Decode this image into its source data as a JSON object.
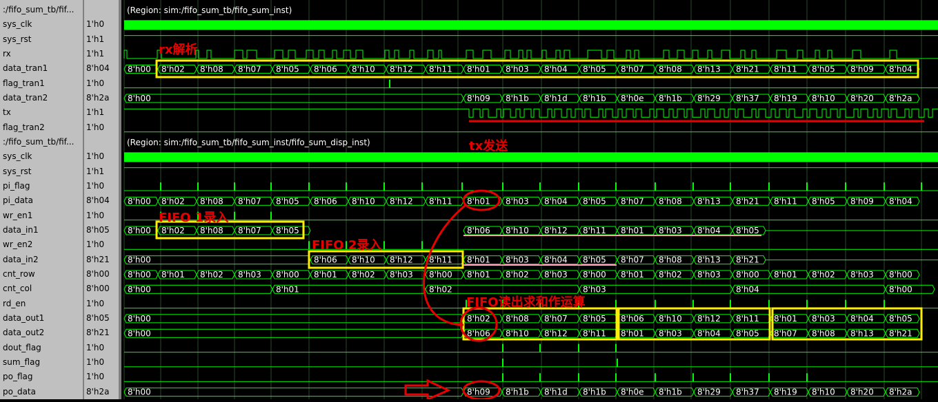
{
  "regions": [
    "(Region: sim:/fifo_sum_tb/fifo_sum_inst)",
    "(Region: sim:/fifo_sum_tb/fifo_sum_inst/fifo_sum_disp_inst)"
  ],
  "signals": [
    {
      "name": ":/fifo_sum_tb/fif...",
      "value": "",
      "kind": "group"
    },
    {
      "name": "sys_clk",
      "value": "1'h0",
      "kind": "clk"
    },
    {
      "name": "sys_rst",
      "value": "1'h1",
      "kind": "high"
    },
    {
      "name": "rx",
      "value": "1'h1",
      "kind": "rx"
    },
    {
      "name": "data_tran1",
      "value": "8'h04",
      "kind": "bus",
      "segs": [
        "8'h00",
        "8'h02",
        "8'h08",
        "8'h07",
        "8'h05",
        "8'h06",
        "8'h10",
        "8'h12",
        "8'h11",
        "8'h01",
        "8'h03",
        "8'h04",
        "8'h05",
        "8'h07",
        "8'h08",
        "8'h13",
        "8'h21",
        "8'h11",
        "8'h05",
        "8'h09",
        "8'h04"
      ]
    },
    {
      "name": "flag_tran1",
      "value": "1'h0",
      "kind": "pulse"
    },
    {
      "name": "data_tran2",
      "value": "8'h2a",
      "kind": "bus2",
      "segs": [
        "8'h00",
        "8'h09",
        "8'h1b",
        "8'h1d",
        "8'h1b",
        "8'h0e",
        "8'h1b",
        "8'h29",
        "8'h37",
        "8'h19",
        "8'h10",
        "8'h20",
        "8'h2a"
      ]
    },
    {
      "name": "tx",
      "value": "1'h1",
      "kind": "tx"
    },
    {
      "name": "flag_tran2",
      "value": "1'h0",
      "kind": "pulse"
    },
    {
      "name": ":/fifo_sum_tb/fif...",
      "value": "",
      "kind": "group"
    },
    {
      "name": "sys_clk",
      "value": "1'h0",
      "kind": "clk"
    },
    {
      "name": "sys_rst",
      "value": "1'h1",
      "kind": "high"
    },
    {
      "name": "pi_flag",
      "value": "1'h0",
      "kind": "pulse"
    },
    {
      "name": "pi_data",
      "value": "8'h04",
      "kind": "bus",
      "segs": [
        "8'h00",
        "8'h02",
        "8'h08",
        "8'h07",
        "8'h05",
        "8'h06",
        "8'h10",
        "8'h12",
        "8'h11",
        "8'h01",
        "8'h03",
        "8'h04",
        "8'h05",
        "8'h07",
        "8'h08",
        "8'h13",
        "8'h21",
        "8'h11",
        "8'h05",
        "8'h09",
        "8'h04"
      ]
    },
    {
      "name": "wr_en1",
      "value": "1'h0",
      "kind": "pulse"
    },
    {
      "name": "data_in1",
      "value": "8'h05",
      "kind": "din1",
      "segs": [
        "8'h00",
        "8'h02",
        "8'h08",
        "8'h07",
        "8'h05",
        "8'h06",
        "8'h10",
        "8'h12",
        "8'h11",
        "8'h01",
        "8'h03",
        "8'h04",
        "8'h05"
      ]
    },
    {
      "name": "wr_en2",
      "value": "1'h0",
      "kind": "pulse"
    },
    {
      "name": "data_in2",
      "value": "8'h21",
      "kind": "din2",
      "segs": [
        "8'h00",
        "8'h06",
        "8'h10",
        "8'h12",
        "8'h11",
        "8'h01",
        "8'h03",
        "8'h04",
        "8'h05",
        "8'h07",
        "8'h08",
        "8'h13",
        "8'h21"
      ]
    },
    {
      "name": "cnt_row",
      "value": "8'h00",
      "kind": "bus",
      "segs": [
        "8'h00",
        "8'h01",
        "8'h02",
        "8'h03",
        "8'h00",
        "8'h01",
        "8'h02",
        "8'h03",
        "8'h00",
        "8'h01",
        "8'h02",
        "8'h03",
        "8'h00",
        "8'h01",
        "8'h02",
        "8'h03",
        "8'h00",
        "8'h01",
        "8'h02",
        "8'h03",
        "8'h00"
      ]
    },
    {
      "name": "cnt_col",
      "value": "8'h00",
      "kind": "col",
      "segs": [
        "8'h00",
        "8'h01",
        "8'h02",
        "8'h03",
        "8'h04",
        "8'h00"
      ]
    },
    {
      "name": "rd_en",
      "value": "1'h0",
      "kind": "pulse"
    },
    {
      "name": "data_out1",
      "value": "8'h05",
      "kind": "dout",
      "segs": [
        "8'h00",
        "8'h02",
        "8'h08",
        "8'h07",
        "8'h05",
        "8'h06",
        "8'h10",
        "8'h12",
        "8'h11",
        "8'h01",
        "8'h03",
        "8'h04",
        "8'h05"
      ]
    },
    {
      "name": "data_out2",
      "value": "8'h21",
      "kind": "dout",
      "segs": [
        "8'h00",
        "8'h06",
        "8'h10",
        "8'h12",
        "8'h11",
        "8'h01",
        "8'h03",
        "8'h04",
        "8'h05",
        "8'h07",
        "8'h08",
        "8'h13",
        "8'h21"
      ]
    },
    {
      "name": "dout_flag",
      "value": "1'h0",
      "kind": "pulse"
    },
    {
      "name": "sum_flag",
      "value": "1'h0",
      "kind": "pulse"
    },
    {
      "name": "po_flag",
      "value": "1'h0",
      "kind": "pulse"
    },
    {
      "name": "po_data",
      "value": "8'h2a",
      "kind": "bus2",
      "segs": [
        "8'h00",
        "8'h09",
        "8'h1b",
        "8'h1d",
        "8'h1b",
        "8'h0e",
        "8'h1b",
        "8'h29",
        "8'h37",
        "8'h19",
        "8'h10",
        "8'h20",
        "8'h2a"
      ]
    }
  ],
  "annotations": {
    "rx_parse": "rx解析",
    "tx_send": "tx发送",
    "fifo1_write": "FIFO 1录入",
    "fifo2_write": "FIFO 2录入",
    "fifo_read_sum": "FIFO读出求和作运算"
  },
  "colors": {
    "wave": "#00ff00",
    "annotation_red": "#e60000",
    "highlight_yellow": "#ffee00",
    "underline_pink": "#ff9eb5",
    "panel_gray": "#c0c0c0"
  }
}
